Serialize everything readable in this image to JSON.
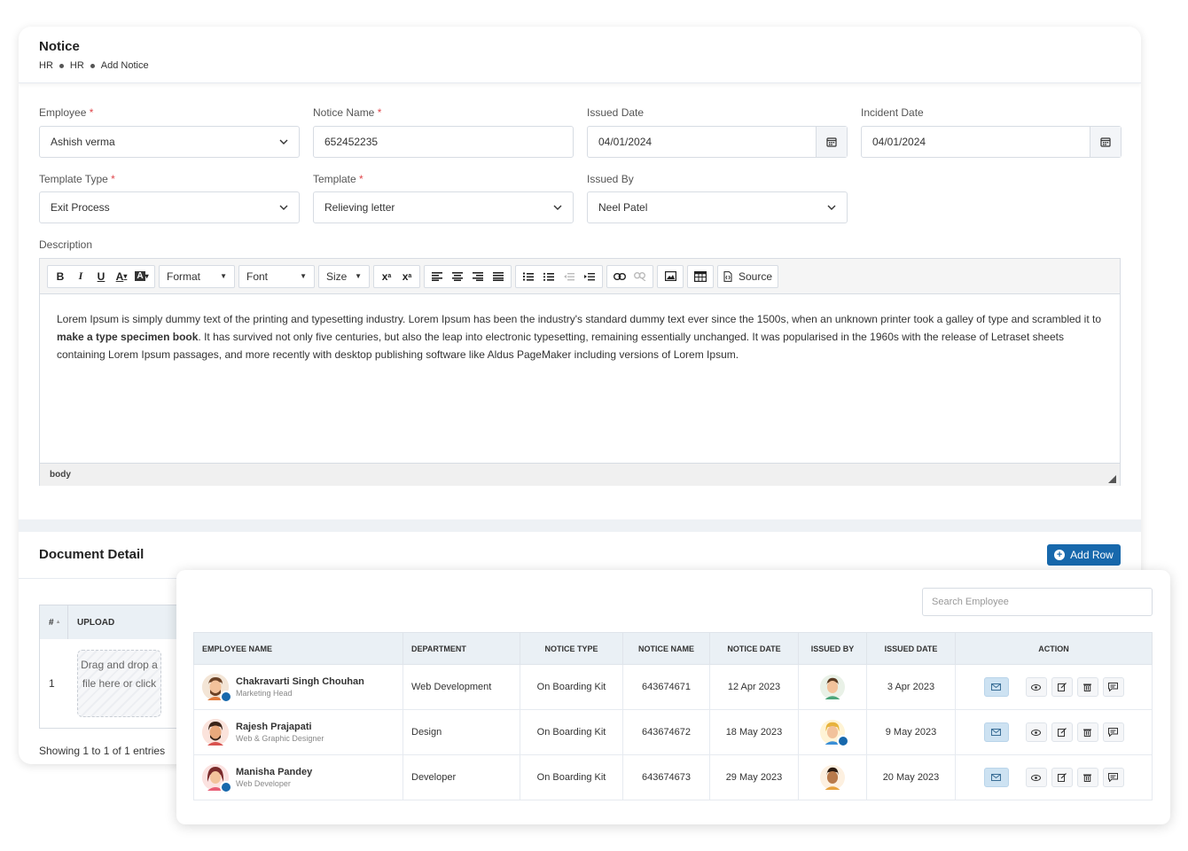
{
  "notice_card": {
    "title": "Notice",
    "breadcrumb": [
      "HR",
      "HR",
      "Add Notice"
    ],
    "fields": {
      "employee": {
        "label": "Employee",
        "value": "Ashish verma"
      },
      "notice_name": {
        "label": "Notice Name",
        "value": "652452235"
      },
      "issued_date": {
        "label": "Issued Date",
        "value": "04/01/2024"
      },
      "incident_date": {
        "label": "Incident Date",
        "value": "04/01/2024"
      },
      "template_type": {
        "label": "Template Type",
        "value": "Exit Process"
      },
      "template": {
        "label": "Template",
        "value": "Relieving letter"
      },
      "issued_by": {
        "label": "Issued By",
        "value": "Neel Patel"
      }
    },
    "required_mark": "*",
    "description_label": "Description",
    "toolbar": {
      "format": "Format",
      "font": "Font",
      "size": "Size",
      "source": "Source",
      "bold": "B",
      "italic": "I",
      "underline": "U"
    },
    "editor_text_1": "Lorem Ipsum is simply dummy text of the printing and typesetting industry. Lorem Ipsum has been the industry's standard dummy text ever since the 1500s, when an unknown printer took a galley of type and scrambled it to ",
    "editor_text_bold": "make a type specimen book",
    "editor_text_2": ". It has survived not only five centuries, but also the leap into electronic typesetting, remaining essentially unchanged. It was popularised in the 1960s with the release of Letraset sheets containing Lorem Ipsum passages, and more recently with desktop publishing software like Aldus PageMaker including versions of Lorem Ipsum.",
    "editor_status": "body"
  },
  "document_detail": {
    "title": "Document Detail",
    "add_row": "Add Row",
    "col_num": "#",
    "col_upload": "UPLOAD",
    "row_num": "1",
    "dropzone": "Drag and drop a file here or click",
    "showing": "Showing 1 to 1 of 1 entries"
  },
  "employee_table": {
    "search_placeholder": "Search Employee",
    "headers": [
      "EMPLOYEE NAME",
      "DEPARTMENT",
      "NOTICE TYPE",
      "NOTICE NAME",
      "NOTICE DATE",
      "ISSUED BY",
      "ISSUED DATE",
      "ACTION"
    ],
    "rows": [
      {
        "name": "Chakravarti Singh Chouhan",
        "role": "Marketing Head",
        "department": "Web Development",
        "notice_type": "On Boarding Kit",
        "notice_name": "643674671",
        "notice_date": "12 Apr 2023",
        "issued_date": "3 Apr 2023"
      },
      {
        "name": "Rajesh Prajapati",
        "role": "Web & Graphic Designer",
        "department": "Design",
        "notice_type": "On Boarding Kit",
        "notice_name": "643674672",
        "notice_date": "18 May 2023",
        "issued_date": "9 May 2023"
      },
      {
        "name": "Manisha Pandey",
        "role": "Web Developer",
        "department": "Developer",
        "notice_type": "On Boarding Kit",
        "notice_name": "643674673",
        "notice_date": "29 May 2023",
        "issued_date": "20 May 2023"
      }
    ]
  },
  "colors": {
    "primary": "#1768ac",
    "link": "#3a8fd6",
    "required": "#e0464b",
    "header_bg": "#eaf0f5"
  }
}
